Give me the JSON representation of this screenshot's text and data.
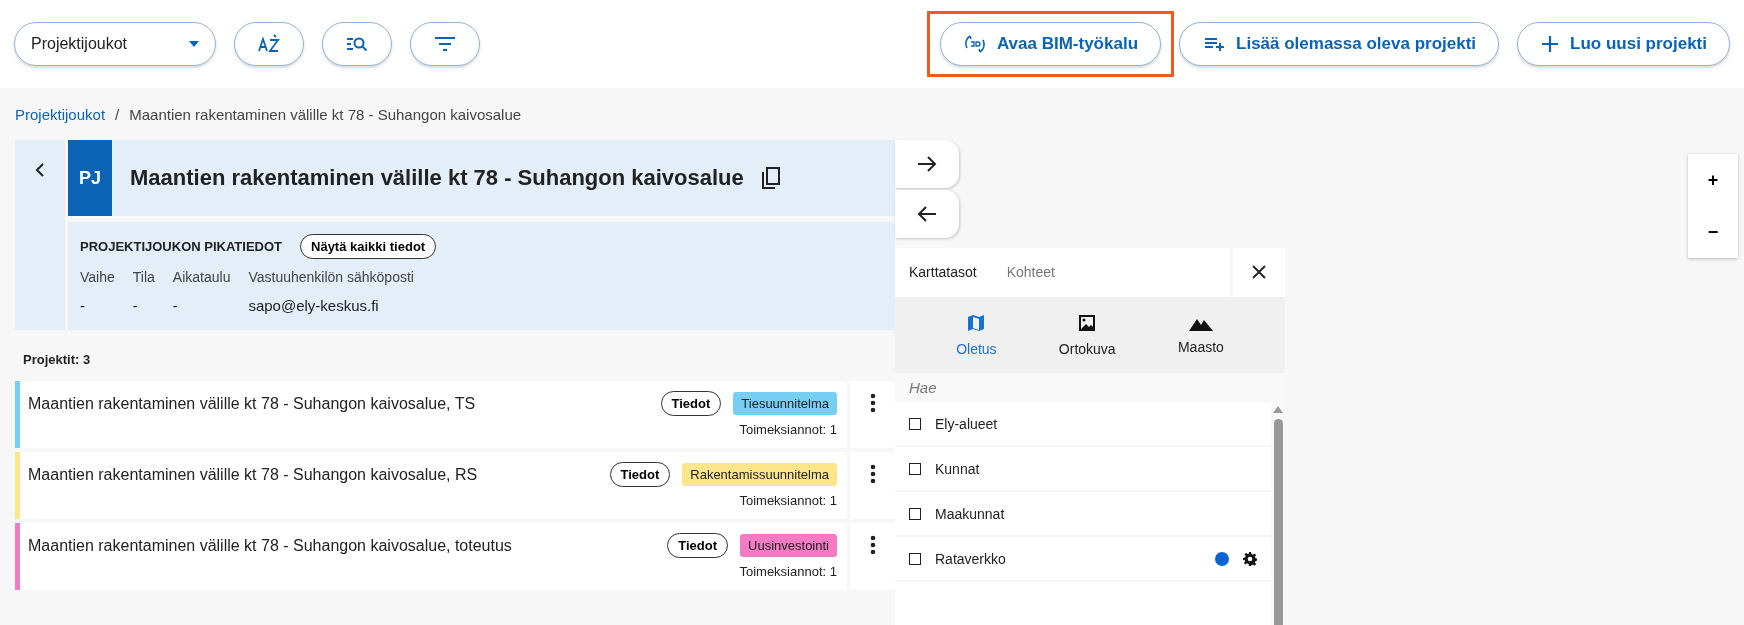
{
  "toolbar": {
    "dropdown": {
      "value": "Projektijoukot"
    },
    "actions": [
      {
        "label": "Avaa BIM-työkalu",
        "kind": "bim",
        "highlighted": true
      },
      {
        "label": "Lisää olemassa oleva projekti",
        "kind": "add-list",
        "highlighted": false
      },
      {
        "label": "Luo uusi projekti",
        "kind": "plus",
        "highlighted": false
      }
    ]
  },
  "breadcrumb": {
    "items": [
      {
        "label": "Projektijoukot",
        "link": true
      },
      {
        "label": "Maantien rakentaminen välille kt 78 - Suhangon kaivosalue",
        "link": false
      }
    ],
    "separator": "/"
  },
  "group": {
    "badge": "PJ",
    "title": "Maantien rakentaminen välille kt 78 - Suhangon kaivosalue",
    "quick_info": {
      "heading": "PROJEKTIJOUKON PIKATIEDOT",
      "button": "Näytä kaikki tiedot",
      "fields": [
        {
          "label": "Vaihe",
          "value": "-"
        },
        {
          "label": "Tila",
          "value": "-"
        },
        {
          "label": "Aikataulu",
          "value": "-"
        },
        {
          "label": "Vastuuhenkilön sähköposti",
          "value": "sapo@ely-keskus.fi"
        }
      ]
    }
  },
  "projects": {
    "count_label": "Projektit: 3",
    "items": [
      {
        "name": "Maantien rakentaminen välille kt 78 - Suhangon kaivosalue, TS",
        "details_button": "Tiedot",
        "tag": "Tiesuunnitelma",
        "color": "#76cff3",
        "assignments": "Toimeksiannot: 1"
      },
      {
        "name": "Maantien rakentaminen välille kt 78 - Suhangon kaivosalue, RS",
        "details_button": "Tiedot",
        "tag": "Rakentamissuunnitelma",
        "color": "#fde58a",
        "assignments": "Toimeksiannot: 1"
      },
      {
        "name": "Maantien rakentaminen välille kt 78 - Suhangon kaivosalue, toteutus",
        "details_button": "Tiedot",
        "tag": "Uusinvestointi",
        "color": "#f27bc4",
        "assignments": "Toimeksiannot: 1"
      }
    ]
  },
  "map": {
    "tabs": [
      {
        "label": "Karttatasot",
        "selected": true
      },
      {
        "label": "Kohteet",
        "selected": false
      }
    ],
    "base_layers": [
      {
        "label": "Oletus",
        "kind": "map",
        "selected": true
      },
      {
        "label": "Ortokuva",
        "kind": "image",
        "selected": false
      },
      {
        "label": "Maasto",
        "kind": "terrain",
        "selected": false
      }
    ],
    "search": {
      "placeholder": "Hae"
    },
    "layers": [
      {
        "label": "Ely-alueet",
        "checked": false,
        "settings": false
      },
      {
        "label": "Kunnat",
        "checked": false,
        "settings": false
      },
      {
        "label": "Maakunnat",
        "checked": false,
        "settings": false
      },
      {
        "label": "Rataverkko",
        "checked": false,
        "settings": true,
        "color": "#0a64d2"
      }
    ],
    "zoom": {
      "in": "+",
      "out": "−"
    }
  }
}
